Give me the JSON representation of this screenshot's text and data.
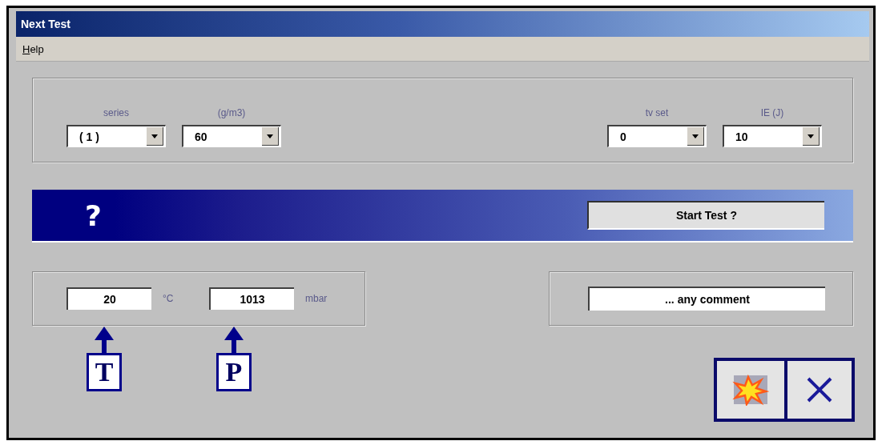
{
  "window": {
    "title": "Next Test"
  },
  "menu": [
    {
      "label": "Help"
    }
  ],
  "left_settings": [
    {
      "label": "series",
      "value": "( 1 )"
    },
    {
      "label": "(g/m3)",
      "value": "60"
    }
  ],
  "right_settings": [
    {
      "label": "tv set",
      "value": "0"
    },
    {
      "label": "IE (J)",
      "value": "10"
    }
  ],
  "banner": {
    "symbol": "?",
    "button": "Start Test ?"
  },
  "conditions": [
    {
      "value": "20",
      "unit": "°C",
      "callout": "T"
    },
    {
      "value": "1013",
      "unit": "mbar",
      "callout": "P"
    }
  ],
  "comment": {
    "value": "... any comment"
  }
}
